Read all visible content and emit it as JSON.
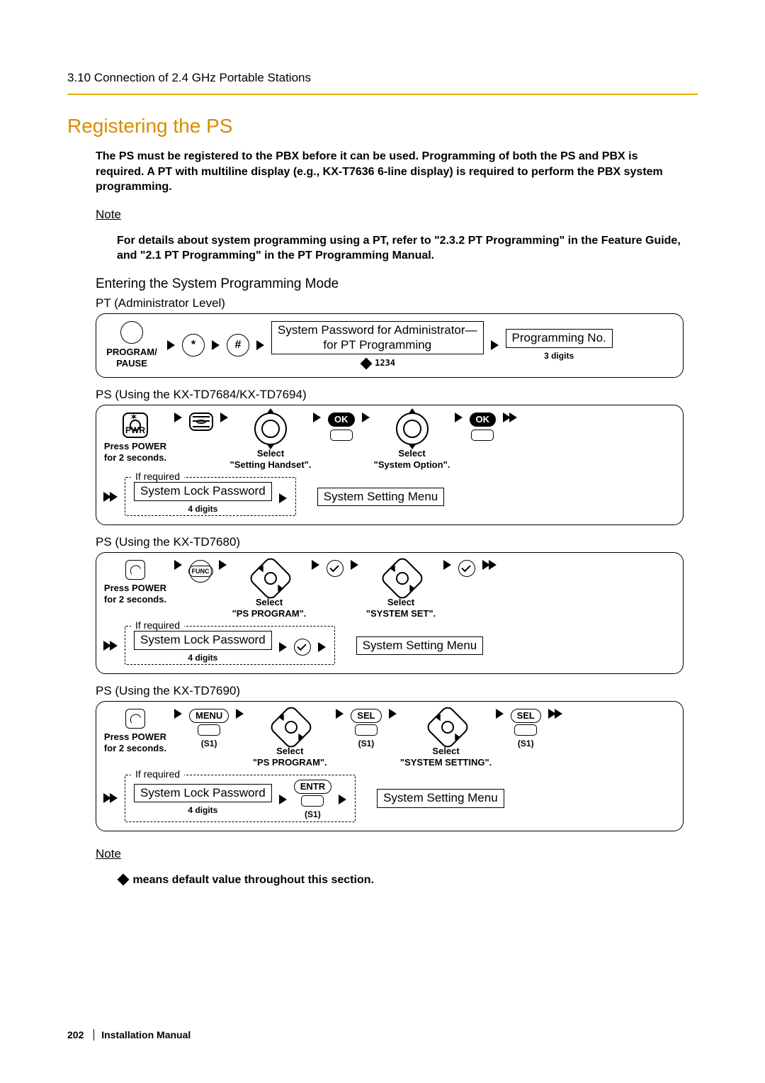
{
  "header": {
    "breadcrumb": "3.10 Connection of 2.4 GHz Portable Stations"
  },
  "title": "Registering the PS",
  "intro": "The PS must be registered to the PBX before it can be used. Programming of both the PS and PBX is required. A PT with multiline display (e.g., KX-T7636 6-line display) is required to perform the PBX system programming.",
  "note1_head": "Note",
  "note1_body": "For details about system programming using a PT, refer to \"2.3.2 PT Programming\" in the Feature Guide, and \"2.1 PT Programming\" in the PT Programming Manual.",
  "mode_head": "Entering the System Programming Mode",
  "blocks": {
    "pt": {
      "head": "PT (Administrator Level)",
      "prog_label": "PROGRAM/\nPAUSE",
      "star": "*",
      "hash": "#",
      "box1a": "System Password for Administrator—",
      "box1b": "for PT Programming",
      "box1_hint": "1234",
      "box2": "Programming No.",
      "box2_hint": "3 digits"
    },
    "ps1": {
      "head": "PS (Using the KX-TD7684/KX-TD7694)",
      "pwr": "PWR",
      "press": "Press POWER\nfor 2 seconds.",
      "sel1": "Select\n\"Setting Handset\".",
      "ok": "OK",
      "sel2": "Select\n\"System Option\".",
      "if_req": "If required",
      "lock": "System Lock Password",
      "lock_hint": "4 digits",
      "menu": "System Setting Menu"
    },
    "ps2": {
      "head": "PS (Using the KX-TD7680)",
      "press": "Press POWER\nfor 2 seconds.",
      "func": "FUNC",
      "sel1": "Select\n\"PS PROGRAM\".",
      "sel2": "Select\n\"SYSTEM SET\".",
      "if_req": "If required",
      "lock": "System Lock Password",
      "lock_hint": "4 digits",
      "menu": "System Setting Menu"
    },
    "ps3": {
      "head": "PS (Using the KX-TD7690)",
      "press": "Press POWER\nfor 2 seconds.",
      "menu_btn": "MENU",
      "s1": "(S1)",
      "sel_btn": "SEL",
      "sel1": "Select\n\"PS PROGRAM\".",
      "sel2": "Select\n\"SYSTEM SETTING\".",
      "entr": "ENTR",
      "if_req": "If required",
      "lock": "System Lock Password",
      "lock_hint": "4 digits",
      "menu": "System Setting Menu"
    }
  },
  "note2_head": "Note",
  "note2_body": " means default value throughout this section.",
  "footer": {
    "page": "202",
    "doc": "Installation Manual"
  }
}
